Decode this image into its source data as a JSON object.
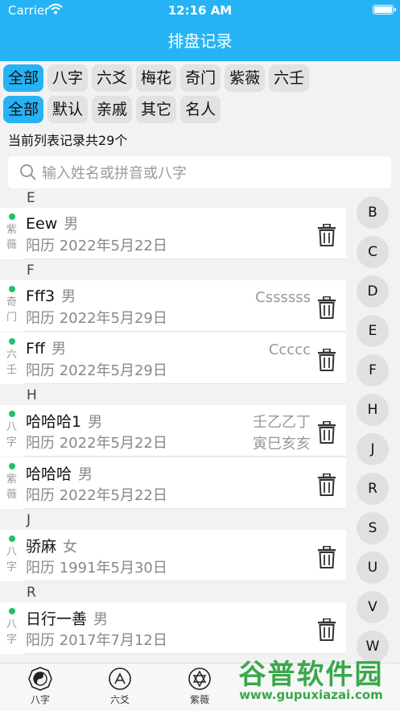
{
  "status_bar": {
    "carrier": "Carrier",
    "time": "12:16 AM"
  },
  "nav": {
    "title": "排盘记录"
  },
  "type_filters": [
    "全部",
    "八字",
    "六爻",
    "梅花",
    "奇门",
    "紫薇",
    "六壬"
  ],
  "group_filters": [
    "全部",
    "默认",
    "亲戚",
    "其它",
    "名人"
  ],
  "count_label": "当前列表记录共29个",
  "search": {
    "placeholder": "输入姓名或拼音或八字"
  },
  "sections": [
    {
      "letter": "E",
      "records": [
        {
          "type": "紫薇",
          "name": "Eew",
          "gender": "男",
          "date": "阳历 2022年5月22日",
          "remark": ""
        }
      ]
    },
    {
      "letter": "F",
      "records": [
        {
          "type": "奇门",
          "name": "Fff3",
          "gender": "男",
          "date": "阳历 2022年5月29日",
          "remark": "Cssssss"
        },
        {
          "type": "六壬",
          "name": "Fff",
          "gender": "男",
          "date": "阳历 2022年5月29日",
          "remark": "Ccccc"
        }
      ]
    },
    {
      "letter": "H",
      "records": [
        {
          "type": "八字",
          "name": "哈哈哈1",
          "gender": "男",
          "date": "阳历 2022年5月22日",
          "remark": "壬乙乙丁",
          "remark2": "寅巳亥亥"
        },
        {
          "type": "紫薇",
          "name": "哈哈哈",
          "gender": "男",
          "date": "阳历 2022年5月22日",
          "remark": ""
        }
      ]
    },
    {
      "letter": "J",
      "records": [
        {
          "type": "八字",
          "name": "骄麻",
          "gender": "女",
          "date": "阳历 1991年5月30日",
          "remark": ""
        }
      ]
    },
    {
      "letter": "R",
      "records": [
        {
          "type": "八字",
          "name": "日行一善",
          "gender": "男",
          "date": "阳历 2017年7月12日",
          "remark": ""
        }
      ]
    }
  ],
  "index_letters": [
    "B",
    "C",
    "D",
    "E",
    "F",
    "H",
    "J",
    "R",
    "S",
    "U",
    "V",
    "W"
  ],
  "tabs": [
    "八字",
    "六爻",
    "紫薇"
  ],
  "watermark": {
    "title": "谷普软件园",
    "url": "www.gupuxiazai.com"
  },
  "colors": {
    "accent": "#26b3f5",
    "status_dot": "#22c06b"
  }
}
